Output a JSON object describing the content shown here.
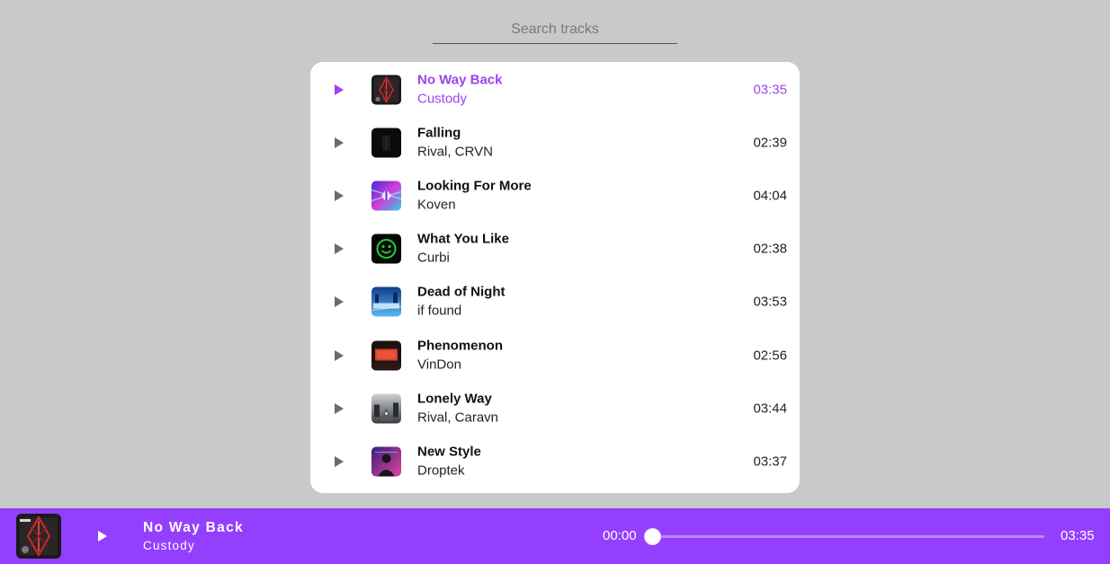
{
  "search": {
    "placeholder": "Search tracks",
    "value": ""
  },
  "colors": {
    "accent": "#943ffe",
    "active_text": "#9b45ea",
    "background": "#c9c9c9"
  },
  "tracks": [
    {
      "title": "No Way Back",
      "artist": "Custody",
      "duration": "03:35",
      "active": true,
      "cover_icon": "album-cover-red-dark"
    },
    {
      "title": "Falling",
      "artist": "Rival, CRVN",
      "duration": "02:39",
      "active": false,
      "cover_icon": "album-cover-black"
    },
    {
      "title": "Looking For More",
      "artist": "Koven",
      "duration": "04:04",
      "active": false,
      "cover_icon": "album-cover-neon-prism"
    },
    {
      "title": "What You Like",
      "artist": "Curbi",
      "duration": "02:38",
      "active": false,
      "cover_icon": "album-cover-green-smiley"
    },
    {
      "title": "Dead of Night",
      "artist": "if found",
      "duration": "03:53",
      "active": false,
      "cover_icon": "album-cover-blue-city"
    },
    {
      "title": "Phenomenon",
      "artist": "VinDon",
      "duration": "02:56",
      "active": false,
      "cover_icon": "album-cover-red-screen"
    },
    {
      "title": "Lonely Way",
      "artist": "Rival, Caravn",
      "duration": "03:44",
      "active": false,
      "cover_icon": "album-cover-grey-street"
    },
    {
      "title": "New Style",
      "artist": "Droptek",
      "duration": "03:37",
      "active": false,
      "cover_icon": "album-cover-portrait-pink"
    }
  ],
  "player": {
    "title": "No Way Back",
    "artist": "Custody",
    "elapsed": "00:00",
    "total": "03:35",
    "progress_fraction": 0.0
  }
}
